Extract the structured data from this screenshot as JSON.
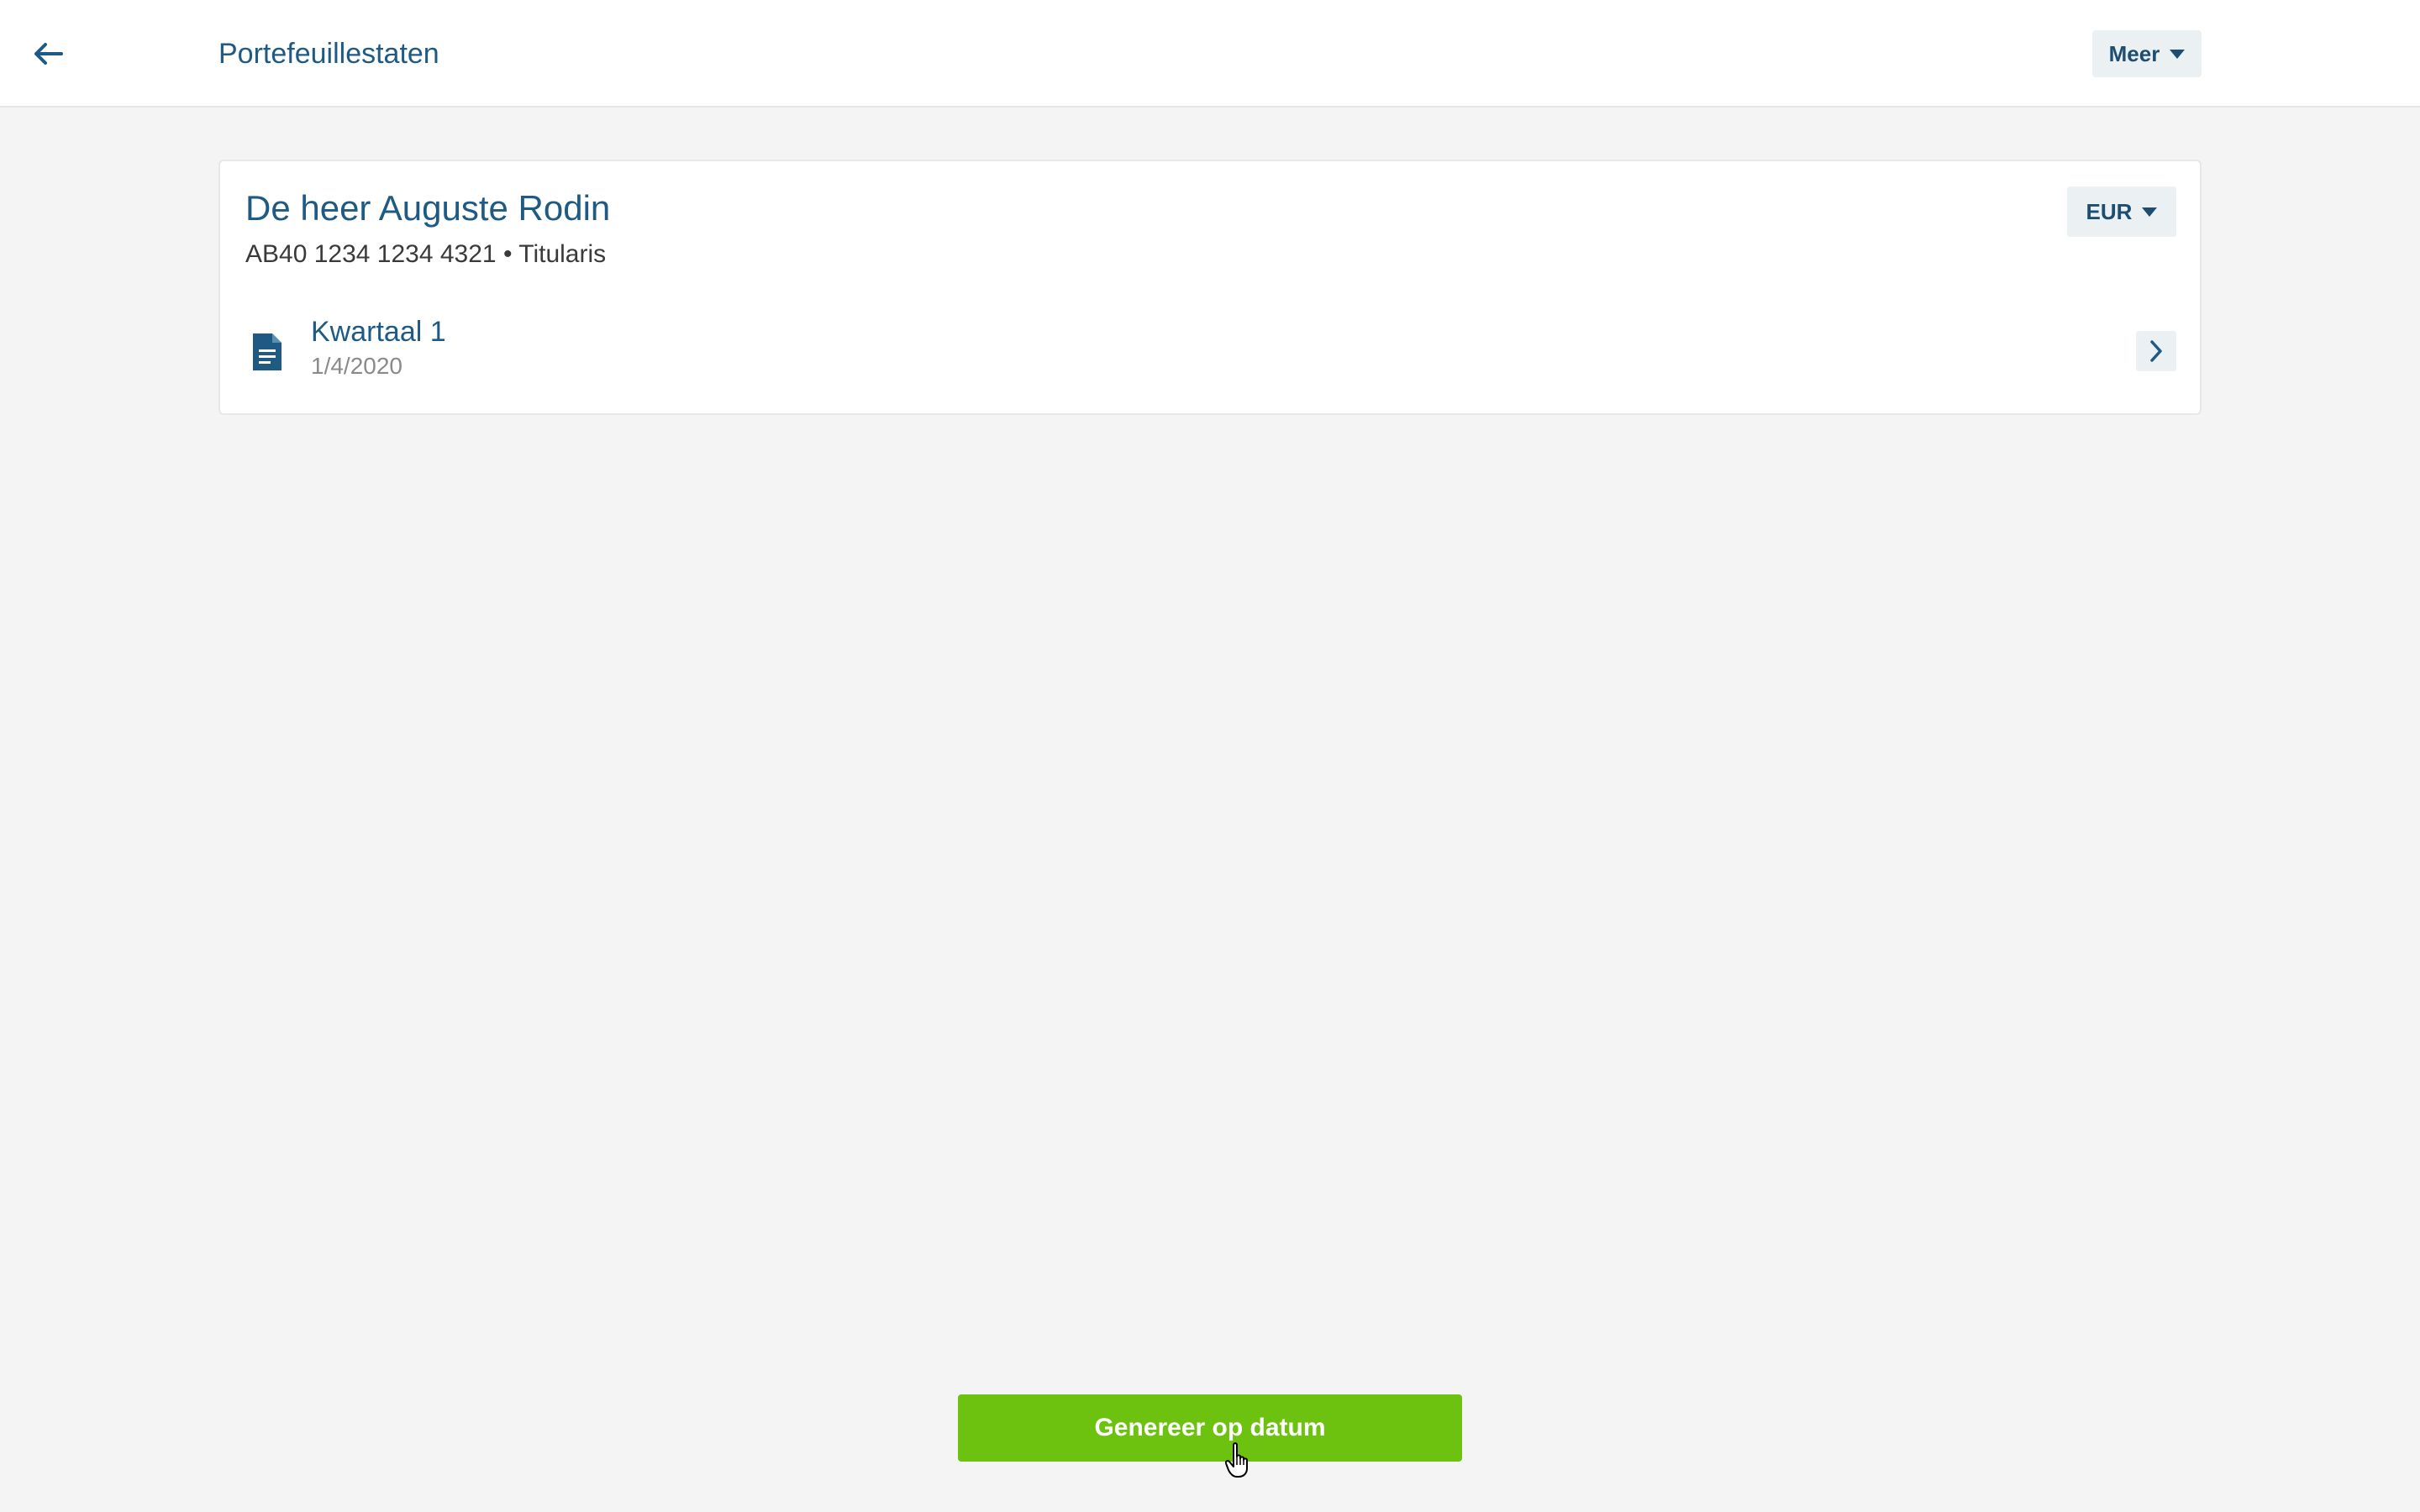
{
  "header": {
    "title": "Portefeuillestaten",
    "back_icon": "arrow-left-icon",
    "more_label": "Meer"
  },
  "client": {
    "name": "De heer Auguste Rodin",
    "account": "AB40 1234 1234 4321 • Titularis",
    "currency": "EUR"
  },
  "statements": [
    {
      "title": "Kwartaal 1",
      "date": "1/4/2020"
    }
  ],
  "footer": {
    "generate_label": "Genereer op datum"
  },
  "colors": {
    "primary": "#1e5a84",
    "accent_green": "#6cc20e",
    "background": "#f4f4f4",
    "button_bg": "#ebf0f3"
  }
}
